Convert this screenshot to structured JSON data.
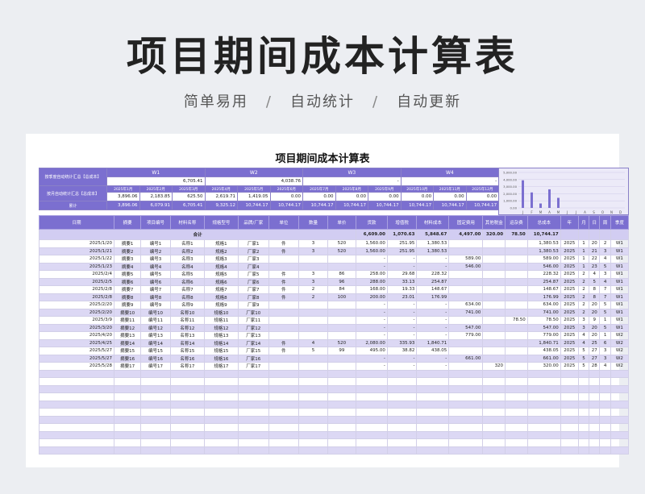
{
  "hero": {
    "title": "项目期间成本计算表",
    "tagline": [
      "简单易用",
      "自动统计",
      "自动更新"
    ],
    "sep": "/"
  },
  "sheet": {
    "title": "项目期间成本计算表",
    "quarter_label": "按季度自动统计汇总【总成本】",
    "month_label": "按月自动统计汇总【总成本】",
    "cumulative_label": "累计",
    "weeks": [
      "W1",
      "W2",
      "W3",
      "W4"
    ],
    "week_values": [
      "6,705.41",
      "4,038.76",
      "-",
      "-"
    ],
    "months": [
      "2025年1月",
      "2025年2月",
      "2025年3月",
      "2025年4月",
      "2025年5月",
      "2025年6月",
      "2025年7月",
      "2025年8月",
      "2025年9月",
      "2025年10月",
      "2025年11月",
      "2025年12月"
    ],
    "month_values": [
      "3,896.06",
      "2,183.85",
      "625.50",
      "2,619.71",
      "1,419.05",
      "0.00",
      "0.00",
      "0.00",
      "0.00",
      "0.00",
      "0.00",
      "0.00"
    ],
    "cumulative": [
      "3,896.06",
      "6,079.91",
      "6,705.41",
      "9,325.12",
      "10,744.17",
      "10,744.17",
      "10,744.17",
      "10,744.17",
      "10,744.17",
      "10,744.17",
      "10,744.17",
      "10,744.17"
    ]
  },
  "chart_data": {
    "type": "bar",
    "categories": [
      "J",
      "F",
      "M",
      "A",
      "M",
      "J",
      "J",
      "A",
      "S",
      "O",
      "N",
      "D"
    ],
    "values": [
      3896.06,
      2183.85,
      625.5,
      2619.71,
      1419.05,
      0,
      0,
      0,
      0,
      0,
      0,
      0
    ],
    "ylim": [
      0,
      5000
    ],
    "yticks": [
      "5,000.00",
      "4,000.00",
      "3,000.00",
      "2,000.00",
      "1,000.00",
      "0.00"
    ],
    "colors": {
      "bar": "#7b6fd0"
    }
  },
  "table": {
    "headers": [
      "日期",
      "摘要",
      "项目编号",
      "材料名称",
      "规格型号",
      "品牌/厂家",
      "单位",
      "数量",
      "单价",
      "货款",
      "增值税",
      "材料成本",
      "固定费用",
      "其他税金",
      "运杂费",
      "总成本",
      "年",
      "月",
      "日",
      "周",
      "季度"
    ],
    "total": {
      "label": "合计",
      "values": [
        "6,609.00",
        "1,070.63",
        "5,848.67",
        "4,497.00",
        "320.00",
        "78.50",
        "10,744.17"
      ]
    },
    "rows": [
      [
        "2025/1/20",
        "摘要1",
        "编号1",
        "名称1",
        "规格1",
        "厂家1",
        "件",
        "3",
        "520",
        "1,560.00",
        "251.95",
        "1,380.53",
        "",
        "",
        "",
        "1,380.53",
        "2025",
        "1",
        "20",
        "2",
        "W1"
      ],
      [
        "2025/1/21",
        "摘要2",
        "编号2",
        "名称2",
        "规格2",
        "厂家2",
        "件",
        "3",
        "520",
        "1,560.00",
        "251.95",
        "1,380.53",
        "",
        "",
        "",
        "1,380.53",
        "2025",
        "1",
        "21",
        "3",
        "W1"
      ],
      [
        "2025/1/22",
        "摘要3",
        "编号3",
        "名称3",
        "规格3",
        "厂家3",
        "",
        "",
        "",
        "-",
        "-",
        "-",
        "589.00",
        "",
        "",
        "589.00",
        "2025",
        "1",
        "22",
        "4",
        "W1"
      ],
      [
        "2025/1/23",
        "摘要4",
        "编号4",
        "名称4",
        "规格4",
        "厂家4",
        "",
        "",
        "",
        "-",
        "-",
        "-",
        "546.00",
        "",
        "",
        "546.00",
        "2025",
        "1",
        "23",
        "5",
        "W1"
      ],
      [
        "2025/2/4",
        "摘要5",
        "编号5",
        "名称5",
        "规格5",
        "厂家5",
        "件",
        "3",
        "86",
        "258.00",
        "29.68",
        "228.32",
        "",
        "",
        "",
        "228.32",
        "2025",
        "2",
        "4",
        "3",
        "W1"
      ],
      [
        "2025/2/5",
        "摘要6",
        "编号6",
        "名称6",
        "规格6",
        "厂家6",
        "件",
        "3",
        "96",
        "288.00",
        "33.13",
        "254.87",
        "",
        "",
        "",
        "254.87",
        "2025",
        "2",
        "5",
        "4",
        "W1"
      ],
      [
        "2025/2/8",
        "摘要7",
        "编号7",
        "名称7",
        "规格7",
        "厂家7",
        "件",
        "2",
        "84",
        "168.00",
        "19.33",
        "148.67",
        "",
        "",
        "",
        "148.67",
        "2025",
        "2",
        "8",
        "7",
        "W1"
      ],
      [
        "2025/2/8",
        "摘要8",
        "编号8",
        "名称8",
        "规格8",
        "厂家8",
        "件",
        "2",
        "100",
        "200.00",
        "23.01",
        "176.99",
        "",
        "",
        "",
        "176.99",
        "2025",
        "2",
        "8",
        "7",
        "W1"
      ],
      [
        "2025/2/20",
        "摘要9",
        "编号9",
        "名称9",
        "规格9",
        "厂家9",
        "",
        "",
        "",
        "-",
        "-",
        "-",
        "634.00",
        "",
        "",
        "634.00",
        "2025",
        "2",
        "20",
        "5",
        "W1"
      ],
      [
        "2025/2/20",
        "摘要10",
        "编号10",
        "名称10",
        "规格10",
        "厂家10",
        "",
        "",
        "",
        "-",
        "-",
        "-",
        "741.00",
        "",
        "",
        "741.00",
        "2025",
        "2",
        "20",
        "5",
        "W1"
      ],
      [
        "2025/3/9",
        "摘要11",
        "编号11",
        "名称11",
        "规格11",
        "厂家11",
        "",
        "",
        "",
        "-",
        "-",
        "-",
        "",
        "",
        "78.50",
        "78.50",
        "2025",
        "3",
        "9",
        "1",
        "W1"
      ],
      [
        "2025/3/20",
        "摘要12",
        "编号12",
        "名称12",
        "规格12",
        "厂家12",
        "",
        "",
        "",
        "-",
        "-",
        "-",
        "547.00",
        "",
        "",
        "547.00",
        "2025",
        "3",
        "20",
        "5",
        "W1"
      ],
      [
        "2025/4/20",
        "摘要13",
        "编号13",
        "名称13",
        "规格13",
        "厂家13",
        "",
        "",
        "",
        "-",
        "-",
        "-",
        "779.00",
        "",
        "",
        "779.00",
        "2025",
        "4",
        "20",
        "1",
        "W2"
      ],
      [
        "2025/4/25",
        "摘要14",
        "编号14",
        "名称14",
        "规格14",
        "厂家14",
        "件",
        "4",
        "520",
        "2,080.00",
        "335.93",
        "1,840.71",
        "",
        "",
        "",
        "1,840.71",
        "2025",
        "4",
        "25",
        "6",
        "W2"
      ],
      [
        "2025/5/27",
        "摘要15",
        "编号15",
        "名称15",
        "规格15",
        "厂家15",
        "件",
        "5",
        "99",
        "495.00",
        "38.82",
        "438.05",
        "",
        "",
        "",
        "438.05",
        "2025",
        "5",
        "27",
        "3",
        "W2"
      ],
      [
        "2025/5/27",
        "摘要16",
        "编号16",
        "名称16",
        "规格16",
        "厂家16",
        "",
        "",
        "",
        "-",
        "-",
        "-",
        "661.00",
        "",
        "",
        "661.00",
        "2025",
        "5",
        "27",
        "3",
        "W2"
      ],
      [
        "2025/5/28",
        "摘要17",
        "编号17",
        "名称17",
        "规格17",
        "厂家17",
        "",
        "",
        "",
        "-",
        "-",
        "-",
        "",
        "320",
        "",
        "320.00",
        "2025",
        "5",
        "28",
        "4",
        "W2"
      ]
    ],
    "empty_rows": 11
  }
}
